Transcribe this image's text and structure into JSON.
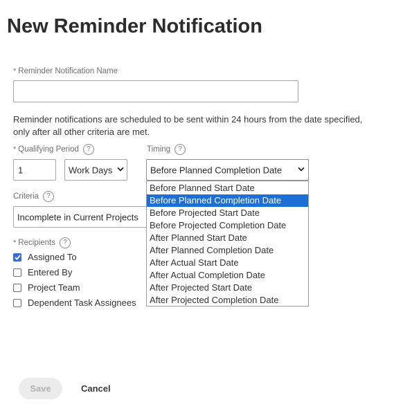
{
  "page": {
    "title": "New Reminder Notification"
  },
  "name_field": {
    "label": "Reminder Notification Name",
    "value": "",
    "required_mark": "*"
  },
  "description": "Reminder notifications are scheduled to be sent within 24 hours from the date specified, only after all other criteria are met.",
  "qualifying_period": {
    "label": "Qualifying Period",
    "required_mark": "*",
    "help": "?",
    "value": "1",
    "unit": "Work Days"
  },
  "timing": {
    "label": "Timing",
    "help": "?",
    "selected": "Before Planned Completion Date",
    "options": [
      "Before Planned Start Date",
      "Before Planned Completion Date",
      "Before Projected Start Date",
      "Before Projected Completion Date",
      "After Planned Start Date",
      "After Planned Completion Date",
      "After Actual Start Date",
      "After Actual Completion Date",
      "After Projected Start Date",
      "After Projected Completion Date"
    ],
    "highlighted_index": 1
  },
  "criteria": {
    "label": "Criteria",
    "help": "?",
    "value": "Incomplete in Current Projects"
  },
  "recipients": {
    "label": "Recipients",
    "required_mark": "*",
    "help": "?",
    "items": [
      {
        "label": "Assigned To",
        "checked": true
      },
      {
        "label": "Entered By",
        "checked": false
      },
      {
        "label": "Project Team",
        "checked": false
      },
      {
        "label": "Dependent Task Assignees",
        "checked": false
      }
    ]
  },
  "actions": {
    "save_label": "Save",
    "cancel_label": "Cancel"
  },
  "colors": {
    "accent": "#1f6ed4",
    "checkbox_on": "#2f6fd7",
    "disabled_button_bg": "#ececec"
  },
  "icons": {
    "chevron": "chevron-down-icon",
    "help": "help-circle-icon",
    "check": "checkmark-icon"
  }
}
